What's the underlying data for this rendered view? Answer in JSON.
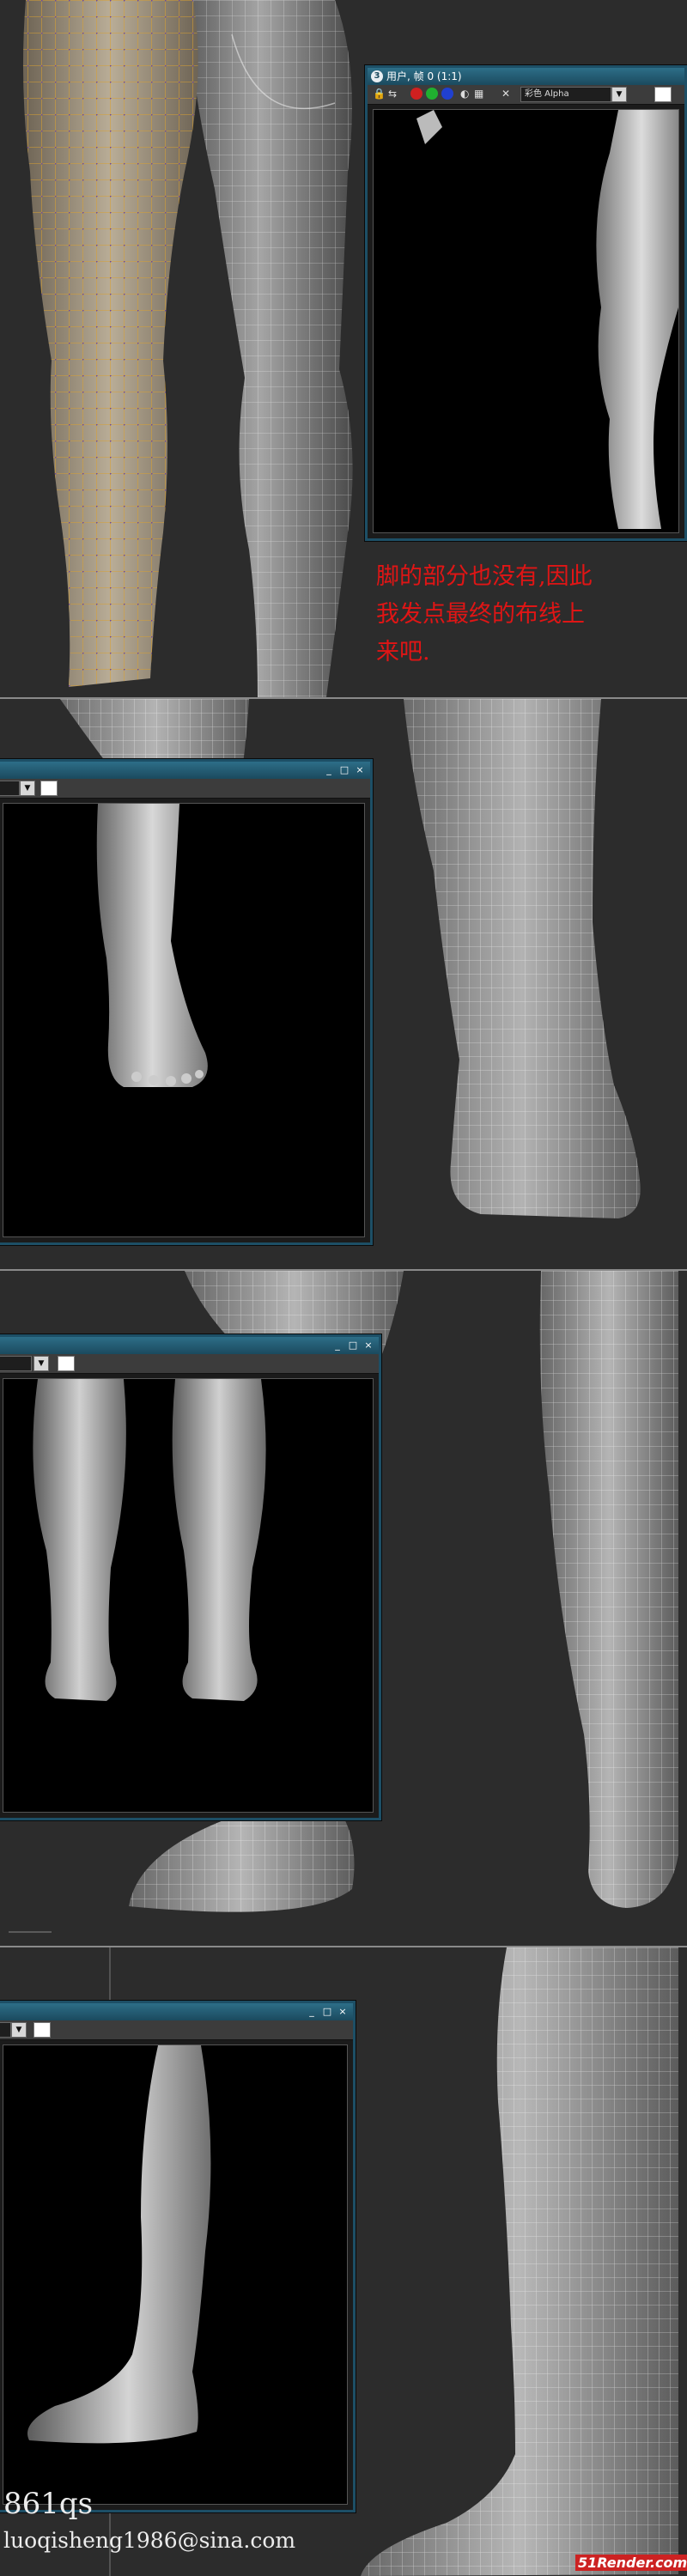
{
  "window_title": "用户, 帧 0 (1:1)",
  "app_icon": "3ds-max-icon",
  "toolbar": {
    "channel_display": "彩色 Alpha"
  },
  "window_controls": {
    "minimize": "_",
    "maximize": "□",
    "close": "×"
  },
  "note_lines": [
    "脚的部分也没有,因此",
    "我发点最终的布线上",
    "来吧."
  ],
  "credit": {
    "handle": "861qs",
    "email": "luoqisheng1986@sina.com"
  },
  "watermark": {
    "text": "51Render.com"
  },
  "colors": {
    "note_red": "#e01515",
    "titlebar": "#1d4f66",
    "wire_orange": "#d9a030",
    "wire_purple": "#6a4aa0"
  }
}
